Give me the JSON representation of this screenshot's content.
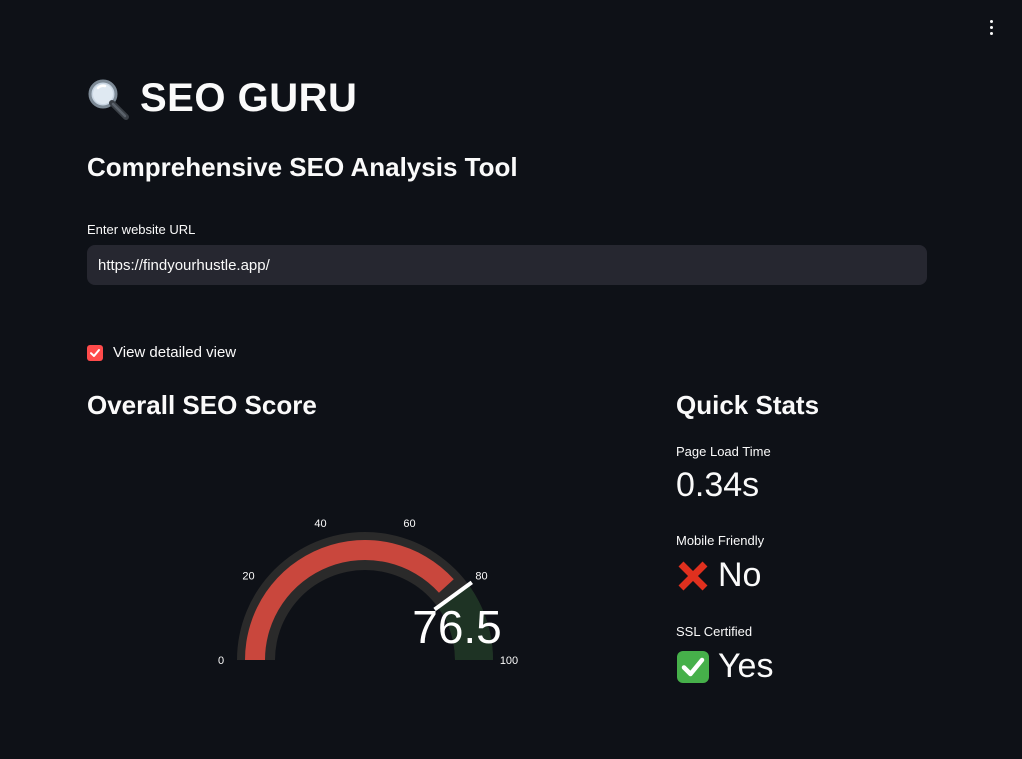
{
  "header": {
    "title": "SEO GURU",
    "title_icon": "magnifier-icon",
    "subtitle": "Comprehensive SEO Analysis Tool"
  },
  "url_input": {
    "label": "Enter website URL",
    "value": "https://findyourhustle.app/"
  },
  "detailed_view": {
    "label": "View detailed view",
    "checked": true
  },
  "seo_score": {
    "section_title": "Overall SEO Score",
    "value": "76.5",
    "ticks": [
      "0",
      "20",
      "40",
      "60",
      "80",
      "100"
    ],
    "range": [
      0,
      100
    ],
    "colors": {
      "bar": "#c9473d",
      "track": "#2a2a2a",
      "good_zone": "#1e3324",
      "threshold": "#ffffff"
    }
  },
  "quick_stats": {
    "section_title": "Quick Stats",
    "items": [
      {
        "label": "Page Load Time",
        "value": "0.34s",
        "icon": ""
      },
      {
        "label": "Mobile Friendly",
        "value": "No",
        "icon": "cross-mark-icon"
      },
      {
        "label": "SSL Certified",
        "value": "Yes",
        "icon": "check-mark-icon"
      }
    ]
  },
  "colors": {
    "background": "#0e1117",
    "input_bg": "#262730",
    "accent": "#ff4b4b",
    "cross": "#e0301e",
    "check_bg": "#46b04a"
  }
}
